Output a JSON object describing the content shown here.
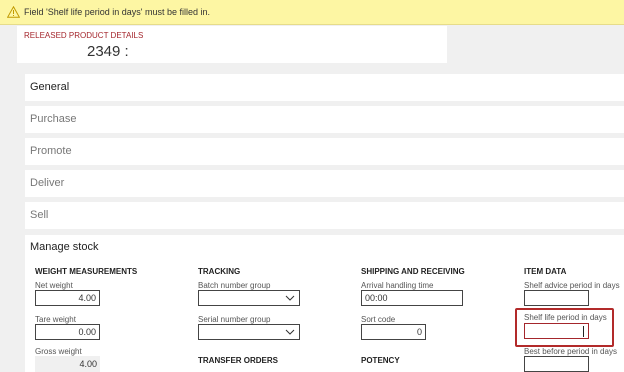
{
  "warning": {
    "icon": "warning-triangle-icon",
    "message": "Field 'Shelf life period in days' must be filled in."
  },
  "header": {
    "caption": "RELEASED PRODUCT DETAILS",
    "title": "2349 :"
  },
  "sections": [
    {
      "label": "General",
      "state": "active"
    },
    {
      "label": "Purchase",
      "state": "collapsed"
    },
    {
      "label": "Promote",
      "state": "collapsed"
    },
    {
      "label": "Deliver",
      "state": "collapsed"
    },
    {
      "label": "Sell",
      "state": "collapsed"
    },
    {
      "label": "Manage stock",
      "state": "expanded"
    }
  ],
  "manage_stock": {
    "weight": {
      "heading": "WEIGHT MEASUREMENTS",
      "net_weight": {
        "label": "Net weight",
        "value": "4.00"
      },
      "tare_weight": {
        "label": "Tare weight",
        "value": "0.00"
      },
      "gross_weight": {
        "label": "Gross weight",
        "value": "4.00"
      }
    },
    "tracking": {
      "heading": "TRACKING",
      "batch_group": {
        "label": "Batch number group",
        "value": ""
      },
      "serial_group": {
        "label": "Serial number group",
        "value": ""
      },
      "transfer_orders_heading": "TRANSFER ORDERS"
    },
    "shipping": {
      "heading": "SHIPPING AND RECEIVING",
      "arrival": {
        "label": "Arrival handling time",
        "value": "00:00"
      },
      "sort_code": {
        "label": "Sort code",
        "value": "0"
      },
      "potency_heading": "POTENCY"
    },
    "item_data": {
      "heading": "ITEM DATA",
      "shelf_advice": {
        "label": "Shelf advice period in days",
        "value": ""
      },
      "shelf_life": {
        "label": "Shelf life period in days",
        "value": ""
      },
      "best_before": {
        "label": "Best before period in days",
        "value": ""
      }
    }
  },
  "colors": {
    "warning_bg": "#fdf6a3",
    "error": "#b22a2a",
    "caption": "#a4262c"
  }
}
